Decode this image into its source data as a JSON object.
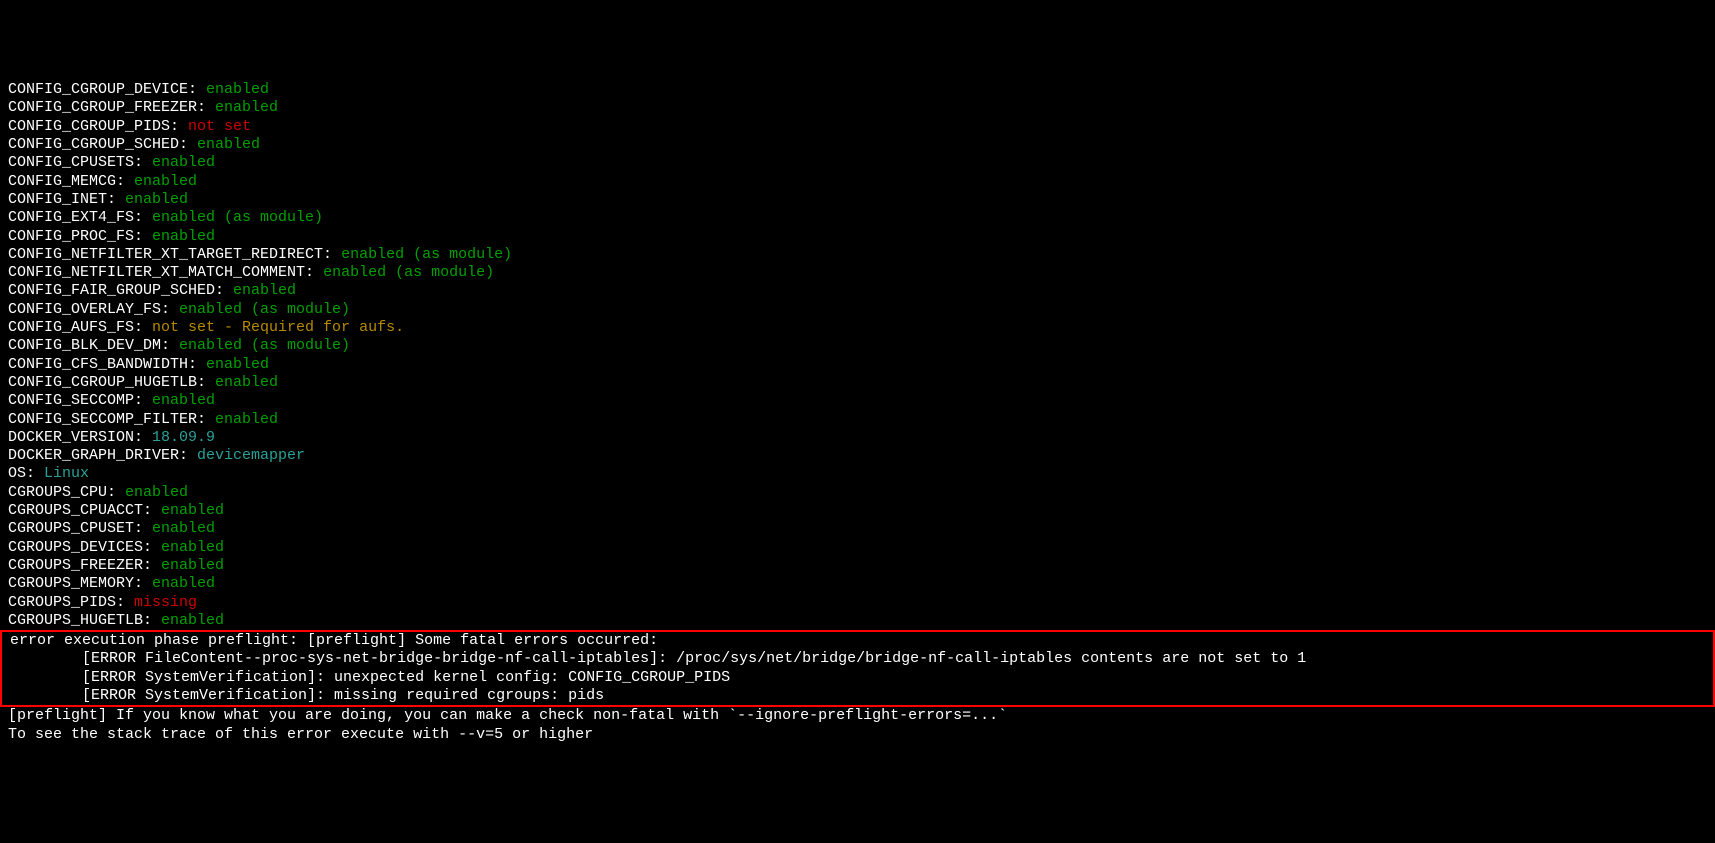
{
  "configs": [
    {
      "key": "CONFIG_CGROUP_DEVICE:",
      "value": "enabled",
      "cls": "enabled"
    },
    {
      "key": "CONFIG_CGROUP_FREEZER:",
      "value": "enabled",
      "cls": "enabled"
    },
    {
      "key": "CONFIG_CGROUP_PIDS:",
      "value": "not set",
      "cls": "notset"
    },
    {
      "key": "CONFIG_CGROUP_SCHED:",
      "value": "enabled",
      "cls": "enabled"
    },
    {
      "key": "CONFIG_CPUSETS:",
      "value": "enabled",
      "cls": "enabled"
    },
    {
      "key": "CONFIG_MEMCG:",
      "value": "enabled",
      "cls": "enabled"
    },
    {
      "key": "CONFIG_INET:",
      "value": "enabled",
      "cls": "enabled"
    },
    {
      "key": "CONFIG_EXT4_FS:",
      "value": "enabled (as module)",
      "cls": "enabled-module"
    },
    {
      "key": "CONFIG_PROC_FS:",
      "value": "enabled",
      "cls": "enabled"
    },
    {
      "key": "CONFIG_NETFILTER_XT_TARGET_REDIRECT:",
      "value": "enabled (as module)",
      "cls": "enabled-module"
    },
    {
      "key": "CONFIG_NETFILTER_XT_MATCH_COMMENT:",
      "value": "enabled (as module)",
      "cls": "enabled-module"
    },
    {
      "key": "CONFIG_FAIR_GROUP_SCHED:",
      "value": "enabled",
      "cls": "enabled"
    },
    {
      "key": "CONFIG_OVERLAY_FS:",
      "value": "enabled (as module)",
      "cls": "enabled-module"
    },
    {
      "key": "CONFIG_AUFS_FS:",
      "value": "not set - Required for aufs.",
      "cls": "yellow"
    },
    {
      "key": "CONFIG_BLK_DEV_DM:",
      "value": "enabled (as module)",
      "cls": "enabled-module"
    },
    {
      "key": "CONFIG_CFS_BANDWIDTH:",
      "value": "enabled",
      "cls": "enabled"
    },
    {
      "key": "CONFIG_CGROUP_HUGETLB:",
      "value": "enabled",
      "cls": "enabled"
    },
    {
      "key": "CONFIG_SECCOMP:",
      "value": "enabled",
      "cls": "enabled"
    },
    {
      "key": "CONFIG_SECCOMP_FILTER:",
      "value": "enabled",
      "cls": "enabled"
    },
    {
      "key": "DOCKER_VERSION:",
      "value": "18.09.9",
      "cls": "teal"
    },
    {
      "key": "DOCKER_GRAPH_DRIVER:",
      "value": "devicemapper",
      "cls": "teal"
    },
    {
      "key": "OS:",
      "value": "Linux",
      "cls": "teal"
    },
    {
      "key": "CGROUPS_CPU:",
      "value": "enabled",
      "cls": "enabled"
    },
    {
      "key": "CGROUPS_CPUACCT:",
      "value": "enabled",
      "cls": "enabled"
    },
    {
      "key": "CGROUPS_CPUSET:",
      "value": "enabled",
      "cls": "enabled"
    },
    {
      "key": "CGROUPS_DEVICES:",
      "value": "enabled",
      "cls": "enabled"
    },
    {
      "key": "CGROUPS_FREEZER:",
      "value": "enabled",
      "cls": "enabled"
    },
    {
      "key": "CGROUPS_MEMORY:",
      "value": "enabled",
      "cls": "enabled"
    },
    {
      "key": "CGROUPS_PIDS:",
      "value": "missing",
      "cls": "missing"
    },
    {
      "key": "CGROUPS_HUGETLB:",
      "value": "enabled",
      "cls": "enabled"
    }
  ],
  "error": {
    "title": "error execution phase preflight: [preflight] Some fatal errors occurred:",
    "lines": [
      "        [ERROR FileContent--proc-sys-net-bridge-bridge-nf-call-iptables]: /proc/sys/net/bridge/bridge-nf-call-iptables contents are not set to 1",
      "        [ERROR SystemVerification]: unexpected kernel config: CONFIG_CGROUP_PIDS",
      "        [ERROR SystemVerification]: missing required cgroups: pids"
    ]
  },
  "trailer": {
    "line1": "[preflight] If you know what you are doing, you can make a check non-fatal with `--ignore-preflight-errors=...`",
    "line2": "To see the stack trace of this error execute with --v=5 or higher"
  }
}
